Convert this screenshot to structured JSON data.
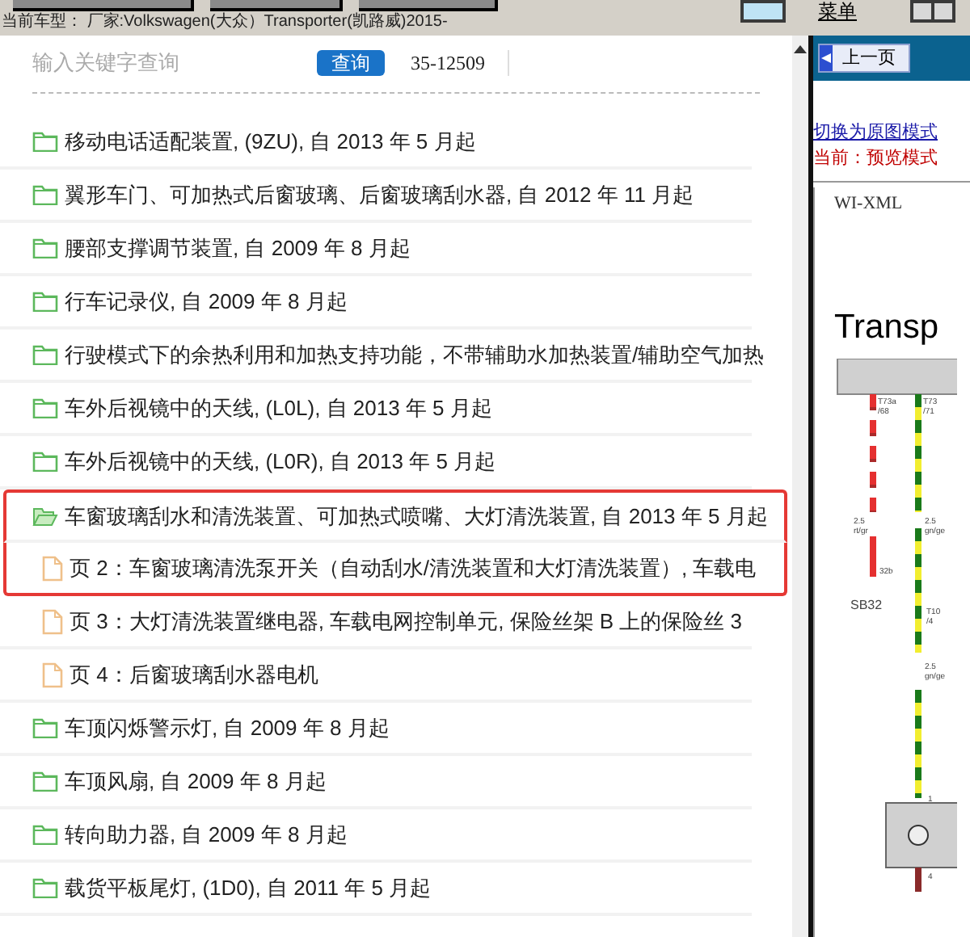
{
  "toolbar": {
    "menu_label": "菜单",
    "vehicle": "当前车型： 厂家:Volkswagen(大众）Transporter(凯路威)2015-"
  },
  "search": {
    "placeholder": "输入关键字查询",
    "button": "查询",
    "code": "35-12509"
  },
  "tree": [
    {
      "kind": "folder",
      "label": "移动电话适配装置, (9ZU), 自 2013 年 5 月起",
      "expanded": false,
      "highlighted": false
    },
    {
      "kind": "folder",
      "label": "翼形车门、可加热式后窗玻璃、后窗玻璃刮水器, 自 2012 年 11 月起",
      "expanded": false,
      "highlighted": false
    },
    {
      "kind": "folder",
      "label": "腰部支撑调节装置, 自 2009 年 8 月起",
      "expanded": false,
      "highlighted": false
    },
    {
      "kind": "folder",
      "label": "行车记录仪, 自 2009 年 8 月起",
      "expanded": false,
      "highlighted": false
    },
    {
      "kind": "folder",
      "label": "行驶模式下的余热利用和加热支持功能，不带辅助水加热装置/辅助空气加热",
      "expanded": false,
      "highlighted": false
    },
    {
      "kind": "folder",
      "label": "车外后视镜中的天线, (L0L), 自 2013 年 5 月起",
      "expanded": false,
      "highlighted": false
    },
    {
      "kind": "folder",
      "label": "车外后视镜中的天线, (L0R), 自 2013 年 5 月起",
      "expanded": false,
      "highlighted": false
    },
    {
      "kind": "folder",
      "label": "车窗玻璃刮水和清洗装置、可加热式喷嘴、大灯清洗装置, 自 2013 年 5 月起",
      "expanded": true,
      "highlighted": true,
      "children": [
        {
          "kind": "page",
          "label": "页 2：车窗玻璃清洗泵开关（自动刮水/清洗装置和大灯清洗装置）, 车载电",
          "highlighted": true
        },
        {
          "kind": "page",
          "label": "页 3：大灯清洗装置继电器, 车载电网控制单元, 保险丝架 B 上的保险丝 3",
          "highlighted": false
        },
        {
          "kind": "page",
          "label": "页 4：后窗玻璃刮水器电机",
          "highlighted": false
        }
      ]
    },
    {
      "kind": "folder",
      "label": "车顶闪烁警示灯, 自 2009 年 8 月起",
      "expanded": false,
      "highlighted": false
    },
    {
      "kind": "folder",
      "label": "车顶风扇, 自 2009 年 8 月起",
      "expanded": false,
      "highlighted": false
    },
    {
      "kind": "folder",
      "label": "转向助力器, 自 2009 年 8 月起",
      "expanded": false,
      "highlighted": false
    },
    {
      "kind": "folder",
      "label": "载货平板尾灯, (1D0), 自 2011 年 5 月起",
      "expanded": false,
      "highlighted": false
    }
  ],
  "viewer": {
    "prev_button": "上一页",
    "mode_link": "切换为原图模式",
    "mode_status": "当前：预览模式",
    "doc_header": "WI-XML",
    "diagram_title": "Transp",
    "wire_labels": [
      "T73a",
      "/68",
      "T73",
      "/71",
      "2.5",
      "rt/gr",
      "2.5",
      "gn/ge",
      "32b",
      "SB32",
      "T10",
      "/4",
      "2.5",
      "gn/ge",
      "1",
      "4"
    ]
  }
}
